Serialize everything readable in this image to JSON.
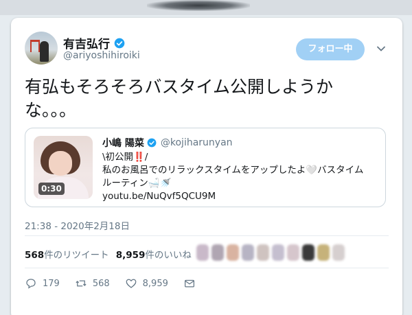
{
  "header": {
    "display_name": "有吉弘行",
    "handle": "@ariyoshihiroiki",
    "follow_label": "フォロー中"
  },
  "tweet": {
    "text": "有弘もそろそろバスタイム公開しようかな。。。",
    "timestamp": "21:38 - 2020年2月18日"
  },
  "quote": {
    "display_name": "小嶋 陽菜",
    "handle": "@kojiharunyan",
    "line1": "\\初公開‼️/",
    "line2": "私のお風呂でのリラックスタイムをアップしたよ🤍バスタイム",
    "line3": "ルーティン🛁🚿",
    "link": "youtu.be/NuQvf5QCU9M",
    "video_duration": "0:30"
  },
  "stats": {
    "retweets_count": "568",
    "retweets_label": "件のリツイート",
    "likes_count": "8,959",
    "likes_label": "件のいいね"
  },
  "actions": {
    "replies": "179",
    "retweets": "568",
    "likes": "8,959"
  },
  "colors": {
    "accent": "#1da1f2",
    "follow_bg": "#a1d0f5",
    "muted": "#657786"
  },
  "likers_colors": [
    "#c9b9c9",
    "#b0a6b2",
    "#d9b3a1",
    "#b7b4c4",
    "#cfc3c0",
    "#c5bfcf",
    "#d6c6cc",
    "#3a3a3a",
    "#c6b27a",
    "#d6cfcf"
  ]
}
